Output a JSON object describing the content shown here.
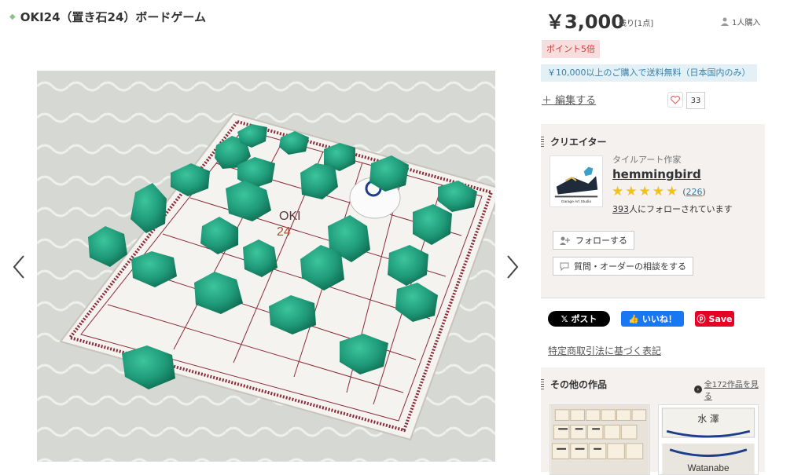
{
  "product": {
    "title": "OKI24（置き石24）ボードゲーム",
    "price": "￥3,000",
    "stock": "残り[1点]",
    "buyers": "1人購入",
    "point_badge": "ポイント5倍",
    "shipping_badge": "￥10,000以上のご購入で送料無料（日本国内のみ）",
    "edit_link": "＋ 編集する",
    "favorite_count": "33"
  },
  "photo": {
    "board_text_line1": "OKI",
    "board_text_line2": "24"
  },
  "creator": {
    "section_title": "クリエイター",
    "role": "タイルアート作家",
    "name": "hemmingbird",
    "avatar_caption": "Garage Art Studio",
    "rating_count": "226",
    "rating_open": "(",
    "rating_close": ")",
    "followers_count": "393",
    "followers_suffix": "人にフォローされています",
    "follow_button": "フォローする",
    "consult_button": "質問・オーダーの相談をする"
  },
  "share": {
    "x_label": "ポスト",
    "fb_label": "いいね！",
    "pin_label": "Save"
  },
  "legal_link": "特定商取引法に基づく表記",
  "others": {
    "section_title": "その他の作品",
    "see_all": "全172作品を見る",
    "thumb2_text": "Watanabe",
    "thumb2_kanji": "水 澤"
  },
  "colors": {
    "accent_red": "#d23c3c",
    "shipping_blue": "#3a7fa5",
    "star": "#f2c11b",
    "stone_green": "#1f9a78"
  }
}
